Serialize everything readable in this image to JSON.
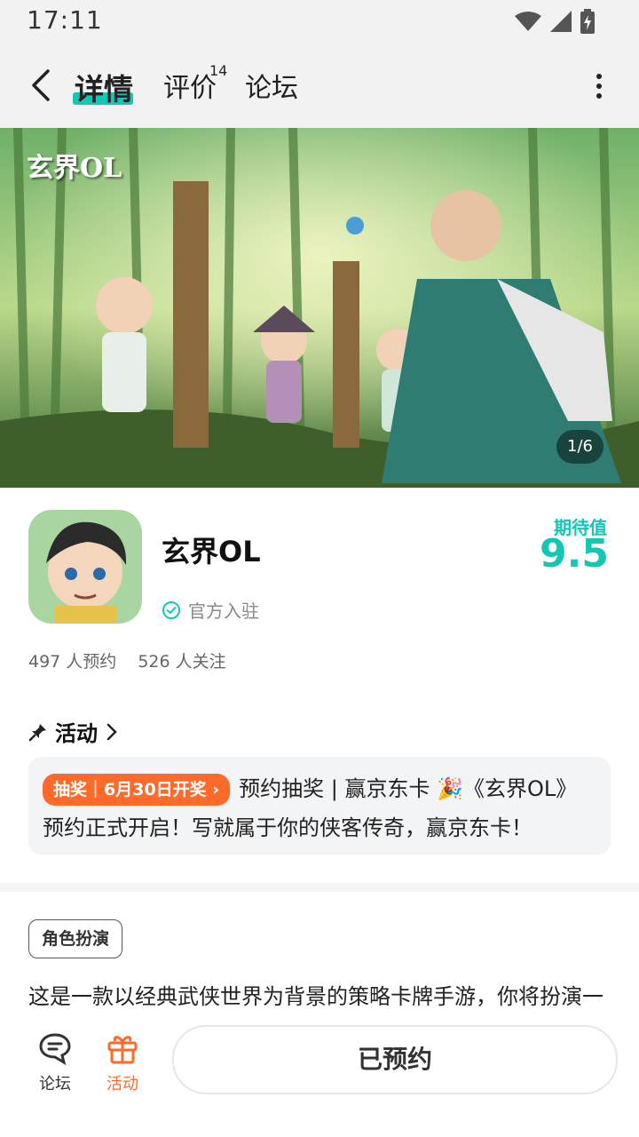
{
  "status_bar": {
    "time": "17:11"
  },
  "nav": {
    "tabs": [
      {
        "label": "详情",
        "active": true
      },
      {
        "label": "评价",
        "badge": "14"
      },
      {
        "label": "论坛"
      }
    ]
  },
  "banner": {
    "logo_text": "玄界OL",
    "counter": "1/6"
  },
  "app": {
    "name": "玄界OL",
    "official_label": "官方入驻",
    "expect_label": "期待值",
    "expect_value": "9.5",
    "reservations": "497 人预约",
    "followers": "526 人关注"
  },
  "activity": {
    "heading": "活动",
    "tag": "抽奖｜6月30日开奖",
    "text": "预约抽奖 | 赢京东卡 🎉《玄界OL》预约正式开启！写就属于你的侠客传奇，赢京东卡！"
  },
  "tags": [
    "角色扮演"
  ],
  "description": "这是一款以经典武侠世界为背景的策略卡牌手游，你将扮演一",
  "bottom": {
    "forum_label": "论坛",
    "activity_label": "活动",
    "reserved_label": "已预约"
  },
  "colors": {
    "accent": "#14c7b5",
    "orange": "#ff6a2b"
  }
}
